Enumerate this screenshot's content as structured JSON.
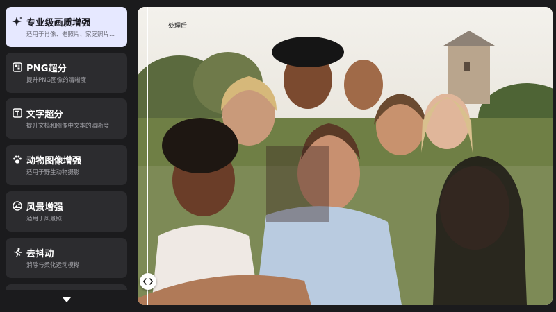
{
  "sidebar": {
    "items": [
      {
        "title": "专业级画质增强",
        "desc": "适用于肖像、老照片、家庭照片...",
        "icon": "sparkle-icon"
      },
      {
        "title": "PNG超分",
        "desc": "提升PNG图像的清晰度",
        "icon": "png-image-icon"
      },
      {
        "title": "文字超分",
        "desc": "提升文档和图像中文本的清晰度",
        "icon": "text-icon"
      },
      {
        "title": "动物图像增强",
        "desc": "适用于野生动物摄影",
        "icon": "paw-icon"
      },
      {
        "title": "风景增强",
        "desc": "适用于风景照",
        "icon": "landscape-icon"
      },
      {
        "title": "去抖动",
        "desc": "消除与柔化运动模糊",
        "icon": "running-figure-icon"
      }
    ],
    "active_index": 0,
    "scroll_icon": "chevron-down-icon"
  },
  "viewer": {
    "after_label": "处理后",
    "handle_icon": "code-arrows-icon"
  },
  "colors": {
    "background": "#1b1b1d",
    "card": "#2c2c2f",
    "active_card": "#e6e8ff"
  }
}
